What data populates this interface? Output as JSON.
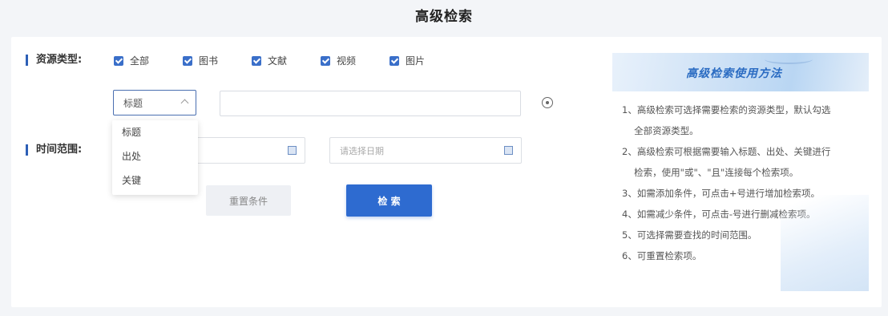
{
  "page": {
    "title": "高级检索"
  },
  "resource_type": {
    "label": "资源类型:",
    "options": [
      "全部",
      "图书",
      "文献",
      "视频",
      "图片"
    ]
  },
  "field_select": {
    "value": "标题",
    "options": [
      "标题",
      "出处",
      "关键"
    ]
  },
  "search": {
    "value": ""
  },
  "time_range": {
    "label": "时间范围:",
    "start_placeholder": "",
    "end_placeholder": "请选择日期"
  },
  "buttons": {
    "reset": "重置条件",
    "search": "检 索"
  },
  "guide": {
    "title": "高级检索使用方法",
    "items": [
      "1、高级检索可选择需要检索的资源类型，默认勾选",
      "　 全部资源类型。",
      "2、高级检索可根据需要输入标题、出处、关键进行",
      "　 检索，使用\"或\"、\"且\"连接每个检索项。",
      "3、如需添加条件，可点击+号进行增加检索项。",
      "4、如需减少条件，可点击-号进行删减检索项。",
      "5、可选择需要查找的时间范围。",
      "6、可重置检索项。"
    ]
  },
  "colors": {
    "accent": "#2e6bd0",
    "section_bar": "#2d5fb6"
  },
  "icons": {
    "add": "add-circle-icon",
    "calendar": "calendar-icon",
    "chevron": "chevron-up-icon"
  }
}
